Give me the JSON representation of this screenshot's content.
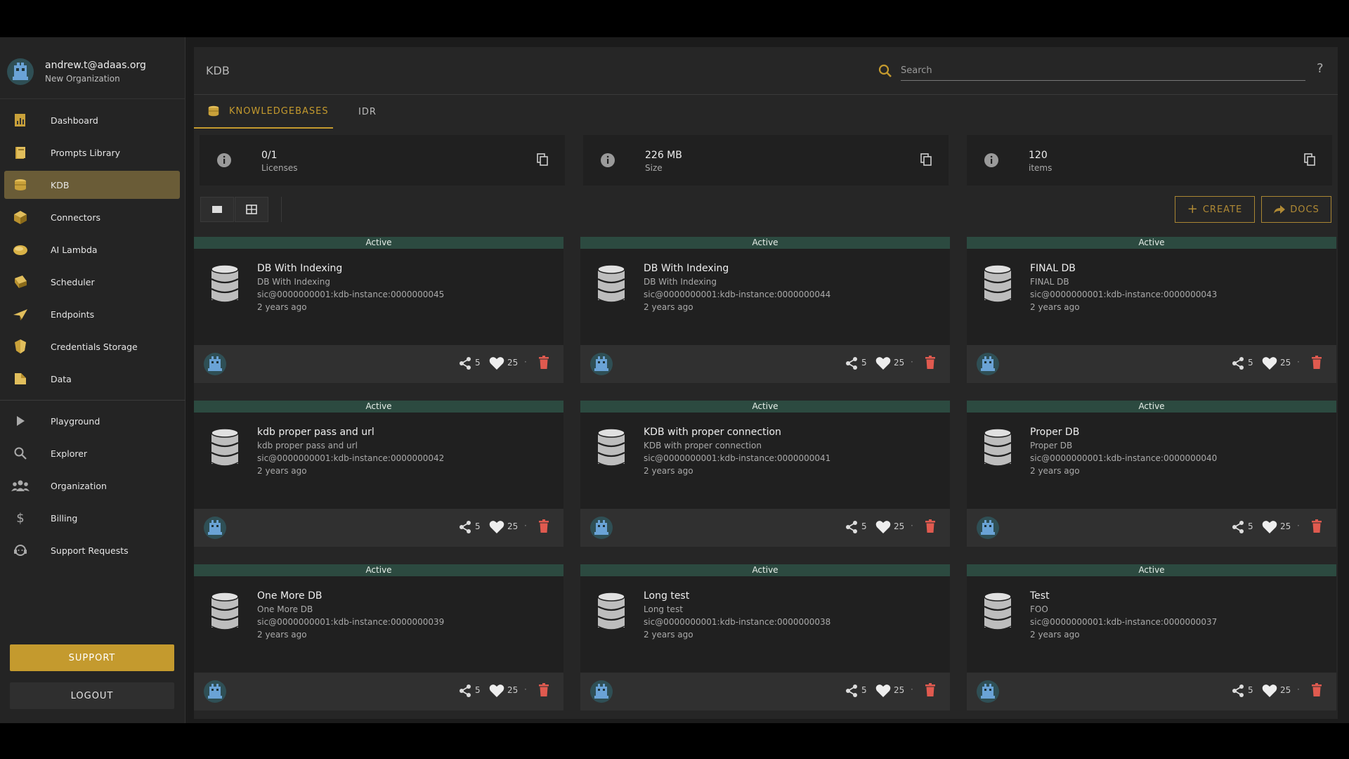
{
  "user": {
    "email": "andrew.t@adaas.org",
    "organization": "New Organization"
  },
  "sidebar": {
    "items": [
      {
        "label": "Dashboard",
        "icon": "dashboard-icon"
      },
      {
        "label": "Prompts Library",
        "icon": "book-icon"
      },
      {
        "label": "KDB",
        "icon": "coins-icon",
        "active": true
      },
      {
        "label": "Connectors",
        "icon": "cube-icon"
      },
      {
        "label": "AI Lambda",
        "icon": "lambda-icon"
      },
      {
        "label": "Scheduler",
        "icon": "calendar-icon"
      },
      {
        "label": "Endpoints",
        "icon": "paper-plane-icon"
      },
      {
        "label": "Credentials Storage",
        "icon": "shield-icon"
      },
      {
        "label": "Data",
        "icon": "folder-icon"
      },
      {
        "label": "Playground",
        "icon": "play-icon"
      },
      {
        "label": "Explorer",
        "icon": "magnifier-icon"
      },
      {
        "label": "Organization",
        "icon": "people-icon"
      },
      {
        "label": "Billing",
        "icon": "dollar-icon"
      },
      {
        "label": "Support Requests",
        "icon": "headset-icon"
      }
    ],
    "support_label": "SUPPORT",
    "logout_label": "LOGOUT"
  },
  "header": {
    "title": "KDB",
    "search_placeholder": "Search",
    "help": "?"
  },
  "tabs": [
    {
      "label": "KNOWLEDGEBASES",
      "active": true
    },
    {
      "label": "IDR",
      "active": false
    }
  ],
  "stats": [
    {
      "value": "0/1",
      "label": "Licenses"
    },
    {
      "value": "226 MB",
      "label": "Size"
    },
    {
      "value": "120",
      "label": "items"
    }
  ],
  "toolbar": {
    "create_label": "CREATE",
    "docs_label": "DOCS"
  },
  "cards": [
    {
      "status": "Active",
      "name": "DB With Indexing",
      "description": "DB With Indexing",
      "id": "sic@0000000001:kdb-instance:0000000045",
      "time": "2 years ago",
      "shares": "5",
      "likes": "25"
    },
    {
      "status": "Active",
      "name": "DB With Indexing",
      "description": "DB With Indexing",
      "id": "sic@0000000001:kdb-instance:0000000044",
      "time": "2 years ago",
      "shares": "5",
      "likes": "25"
    },
    {
      "status": "Active",
      "name": "FINAL DB",
      "description": "FINAL DB",
      "id": "sic@0000000001:kdb-instance:0000000043",
      "time": "2 years ago",
      "shares": "5",
      "likes": "25"
    },
    {
      "status": "Active",
      "name": "kdb proper pass and url",
      "description": "kdb proper pass and url",
      "id": "sic@0000000001:kdb-instance:0000000042",
      "time": "2 years ago",
      "shares": "5",
      "likes": "25"
    },
    {
      "status": "Active",
      "name": "KDB with proper connection",
      "description": "KDB with proper connection",
      "id": "sic@0000000001:kdb-instance:0000000041",
      "time": "2 years ago",
      "shares": "5",
      "likes": "25"
    },
    {
      "status": "Active",
      "name": "Proper DB",
      "description": "Proper DB",
      "id": "sic@0000000001:kdb-instance:0000000040",
      "time": "2 years ago",
      "shares": "5",
      "likes": "25"
    },
    {
      "status": "Active",
      "name": "One More DB",
      "description": "One More DB",
      "id": "sic@0000000001:kdb-instance:0000000039",
      "time": "2 years ago",
      "shares": "5",
      "likes": "25"
    },
    {
      "status": "Active",
      "name": "Long test",
      "description": "Long test",
      "id": "sic@0000000001:kdb-instance:0000000038",
      "time": "2 years ago",
      "shares": "5",
      "likes": "25"
    },
    {
      "status": "Active",
      "name": "Test",
      "description": "FOO",
      "id": "sic@0000000001:kdb-instance:0000000037",
      "time": "2 years ago",
      "shares": "5",
      "likes": "25"
    }
  ],
  "colors": {
    "accent": "#c49a2e",
    "active_nav": "#6a5c37",
    "status_bar": "#2c4a40",
    "delete": "#e05a4f",
    "avatar": "#5a8fc0"
  }
}
